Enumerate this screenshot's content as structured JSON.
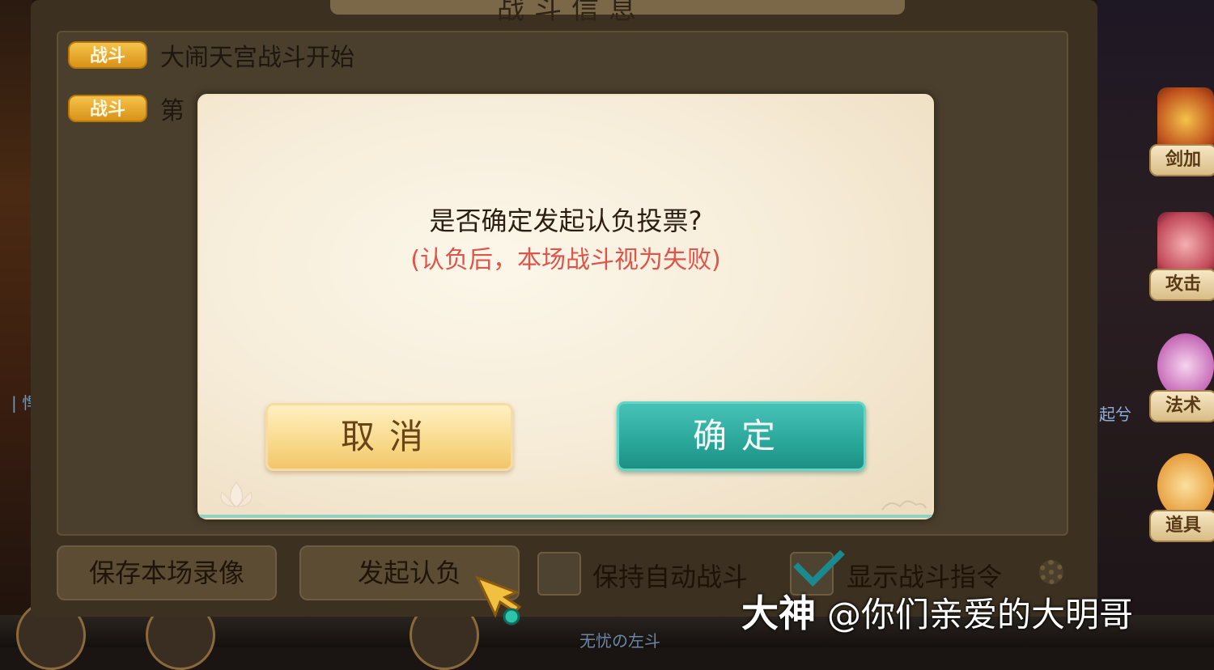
{
  "panel": {
    "title": "战斗信息",
    "log": [
      {
        "tag": "战斗",
        "text": "大闹天宫战斗开始"
      },
      {
        "tag": "战斗",
        "text": "第"
      }
    ],
    "save_replay_label": "保存本场录像",
    "surrender_label": "发起认负",
    "auto_battle_label": "保持自动战斗",
    "auto_battle_checked": false,
    "show_commands_label": "显示战斗指令",
    "show_commands_checked": true
  },
  "dialog": {
    "question": "是否确定发起认负投票?",
    "note": "(认负后，本场战斗视为失败)",
    "cancel_label": "取消",
    "confirm_label": "确定"
  },
  "side_skills": [
    {
      "label": "剑加",
      "icon": "sword-skill-icon"
    },
    {
      "label": "攻击",
      "icon": "attack-icon"
    },
    {
      "label": "法术",
      "icon": "magic-icon"
    },
    {
      "label": "道具",
      "icon": "item-icon"
    }
  ],
  "scene": {
    "left_hint": "| 悍",
    "right_hint": "起兮",
    "bottom_text": "无忧の左斗"
  },
  "watermark": {
    "brand": "大神",
    "handle": "@你们亲爱的大明哥"
  },
  "colors": {
    "confirm_button": "#2aa79a",
    "cancel_button": "#f8d98a",
    "note_text": "#e0544a",
    "tag": "#f5c34a"
  }
}
